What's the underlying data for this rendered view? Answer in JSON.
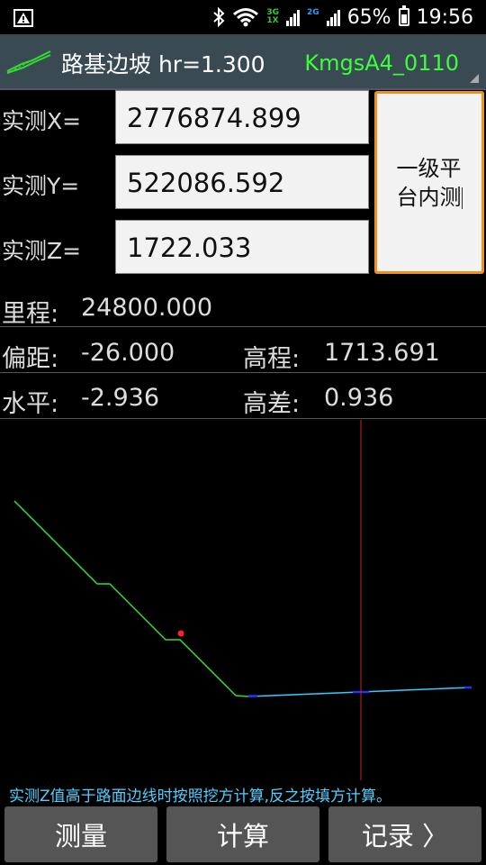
{
  "status": {
    "net_top": "3G",
    "net_bottom": "1X",
    "net2": "2G",
    "battery": "65%",
    "time": "19:56"
  },
  "header": {
    "title": "路基边坡 hr=1.300",
    "project": "KmgsA4_0110"
  },
  "fields": [
    {
      "label": "实测X=",
      "value": "2776874.899"
    },
    {
      "label": "实测Y=",
      "value": "522086.592"
    },
    {
      "label": "实测Z=",
      "value": "1722.033"
    }
  ],
  "mode_button": {
    "line1": "一级平",
    "line2": "台内测"
  },
  "info": {
    "mileage_label": "里程:",
    "mileage_value": "24800.000",
    "offset_label": "偏距:",
    "offset_value": "-26.000",
    "elev_label": "高程:",
    "elev_value": "1713.691",
    "horiz_label": "水平:",
    "horiz_value": "-2.936",
    "diff_label": "高差:",
    "diff_value": "0.936"
  },
  "hint": "实测Z值高于路面边线时按照挖方计算,反之按填方计算。",
  "buttons": {
    "measure": "测量",
    "calc": "计算",
    "record": "记录 〉"
  },
  "colors": {
    "slope_line": "#33dd33",
    "road_line": "#33ccff",
    "marker": "#ff2222",
    "crosshair": "#cc2222",
    "accent_border": "#f09020"
  }
}
